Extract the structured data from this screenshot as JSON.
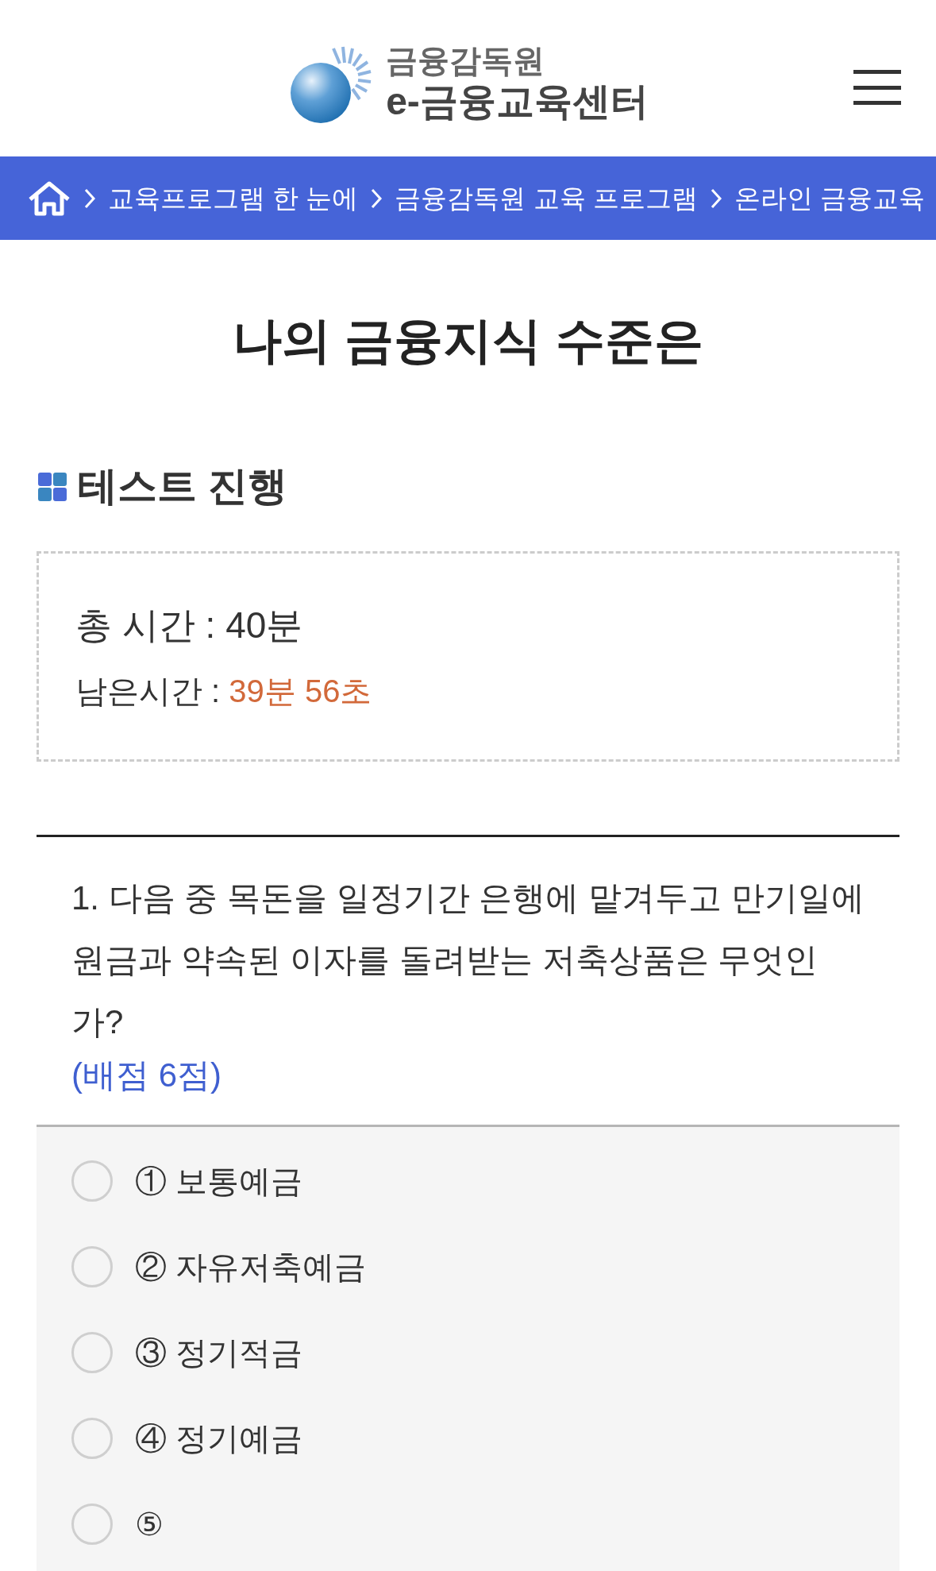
{
  "header": {
    "logo_top": "금융감독원",
    "logo_bottom": "e-금융교육센터"
  },
  "breadcrumb": [
    "교육프로그램 한 눈에",
    "금융감독원 교육 프로그램",
    "온라인 금융교육"
  ],
  "page_title": "나의 금융지식 수준은",
  "section_title": "테스트 진행",
  "timer": {
    "total_label": "총 시간 : ",
    "total_value": "40분",
    "remaining_label": "남은시간 : ",
    "remaining_value": "39분 56초"
  },
  "question": {
    "text": "1. 다음 중 목돈을 일정기간 은행에 맡겨두고 만기일에 원금과 약속된 이자를 돌려받는 저축상품은 무엇인가?",
    "score": "(배점 6점)"
  },
  "options": [
    {
      "label": "① 보통예금",
      "selected": false
    },
    {
      "label": "② 자유저축예금",
      "selected": false
    },
    {
      "label": "③ 정기적금",
      "selected": false
    },
    {
      "label": "④ 정기예금",
      "selected": false
    },
    {
      "label": "⑤",
      "selected": false
    }
  ]
}
